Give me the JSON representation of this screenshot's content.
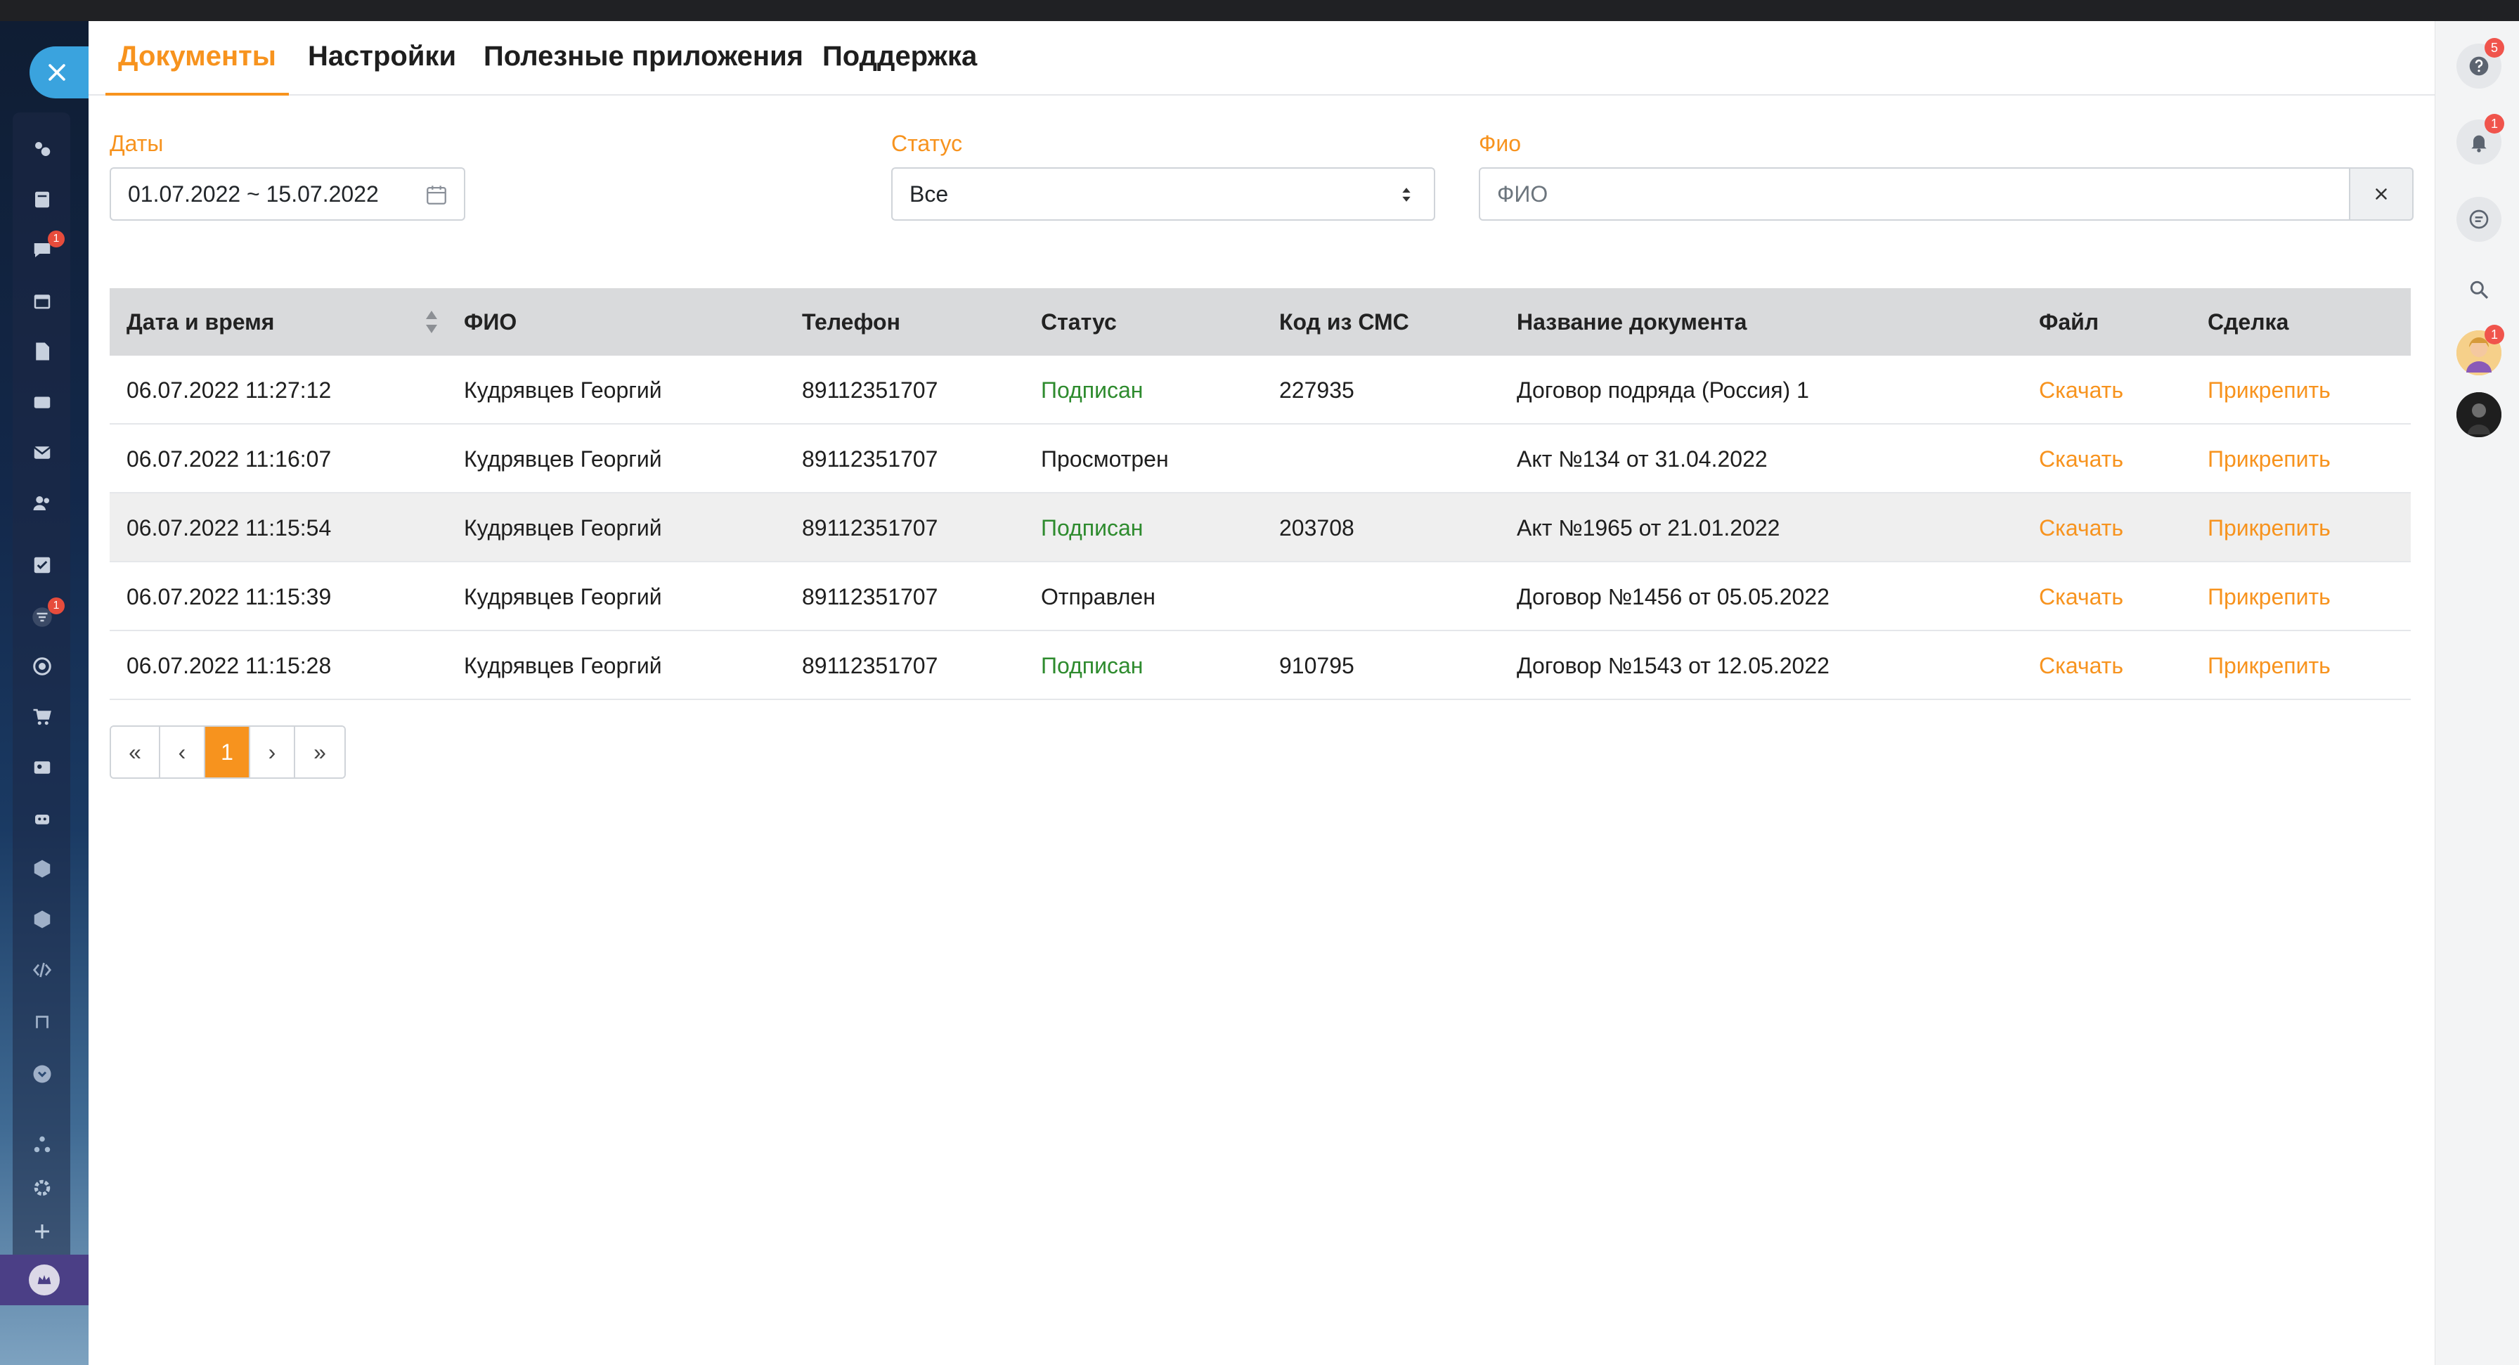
{
  "tabs": [
    {
      "label": "Документы",
      "active": true
    },
    {
      "label": "Настройки",
      "active": false
    },
    {
      "label": "Полезные приложения",
      "active": false
    },
    {
      "label": "Поддержка",
      "active": false
    }
  ],
  "filters": {
    "dates_label": "Даты",
    "dates_value": "01.07.2022 ~ 15.07.2022",
    "status_label": "Статус",
    "status_value": "Все",
    "fio_label": "Фио",
    "fio_placeholder": "ФИО"
  },
  "table": {
    "columns": [
      "Дата и время",
      "ФИО",
      "Телефон",
      "Статус",
      "Код из СМС",
      "Название документа",
      "Файл",
      "Сделка"
    ],
    "rows": [
      {
        "datetime": "06.07.2022 11:27:12",
        "fio": "Кудрявцев Георгий",
        "phone": "89112351707",
        "status": "Подписан",
        "code": "227935",
        "doc": "Договор подряда (Россия) 1",
        "file": "Скачать",
        "deal": "Прикрепить"
      },
      {
        "datetime": "06.07.2022 11:16:07",
        "fio": "Кудрявцев Георгий",
        "phone": "89112351707",
        "status": "Просмотрен",
        "code": "",
        "doc": "Акт №134 от 31.04.2022",
        "file": "Скачать",
        "deal": "Прикрепить"
      },
      {
        "datetime": "06.07.2022 11:15:54",
        "fio": "Кудрявцев Георгий",
        "phone": "89112351707",
        "status": "Подписан",
        "code": "203708",
        "doc": "Акт №1965 от 21.01.2022",
        "file": "Скачать",
        "deal": "Прикрепить"
      },
      {
        "datetime": "06.07.2022 11:15:39",
        "fio": "Кудрявцев Георгий",
        "phone": "89112351707",
        "status": "Отправлен",
        "code": "",
        "doc": "Договор №1456 от 05.05.2022",
        "file": "Скачать",
        "deal": "Прикрепить"
      },
      {
        "datetime": "06.07.2022 11:15:28",
        "fio": "Кудрявцев Георгий",
        "phone": "89112351707",
        "status": "Подписан",
        "code": "910795",
        "doc": "Договор №1543 от 12.05.2022",
        "file": "Скачать",
        "deal": "Прикрепить"
      }
    ]
  },
  "pagination": {
    "first": "«",
    "prev": "‹",
    "current": "1",
    "next": "›",
    "last": "»"
  },
  "sidebar_badges": {
    "chat": "1",
    "filter": "1"
  },
  "right_badges": {
    "help": "5",
    "notifications": "1",
    "avatar": "1"
  },
  "colors": {
    "accent": "#f7931e",
    "signed": "#2e8b2e",
    "header_bg": "#d9dadc",
    "sidebar_close": "#3aa3de"
  },
  "icons": {
    "left": [
      "close-icon",
      "dashboard-icon",
      "feed-icon",
      "chat-icon",
      "calendar-icon",
      "document-icon",
      "inbox-icon",
      "mail-icon",
      "users-icon",
      "tasks-icon",
      "filter-icon",
      "target-icon",
      "cart-icon",
      "contacts-icon",
      "robot-icon",
      "box-icon",
      "box2-icon",
      "code-icon",
      "app-icon",
      "more-icon",
      "sitemap-icon",
      "settings-icon",
      "plus-icon",
      "crown-icon"
    ],
    "right": [
      "help-icon",
      "bell-icon",
      "chat-bubble-icon",
      "search-icon"
    ]
  }
}
